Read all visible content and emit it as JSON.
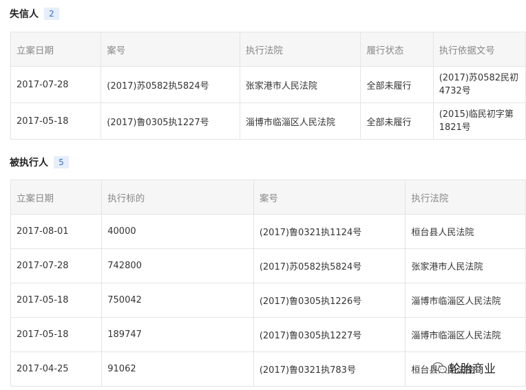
{
  "dishonest": {
    "title": "失信人",
    "count": "2",
    "headers": [
      "立案日期",
      "案号",
      "执行法院",
      "履行状态",
      "执行依据文号"
    ],
    "rows": [
      [
        "2017-07-28",
        "(2017)苏0582执5824号",
        "张家港市人民法院",
        "全部未履行",
        "(2017)苏0582民初4732号"
      ],
      [
        "2017-05-18",
        "(2017)鲁0305执1227号",
        "淄博市临淄区人民法院",
        "全部未履行",
        "(2015)临民初字第1821号"
      ]
    ]
  },
  "executed": {
    "title": "被执行人",
    "count": "5",
    "headers": [
      "立案日期",
      "执行标的",
      "案号",
      "执行法院"
    ],
    "rows": [
      [
        "2017-08-01",
        "40000",
        "(2017)鲁0321执1124号",
        "桓台县人民法院"
      ],
      [
        "2017-07-28",
        "742800",
        "(2017)苏0582执5824号",
        "张家港市人民法院"
      ],
      [
        "2017-05-18",
        "750042",
        "(2017)鲁0305执1226号",
        "淄博市临淄区人民法院"
      ],
      [
        "2017-05-18",
        "189747",
        "(2017)鲁0305执1227号",
        "淄博市临淄区人民法院"
      ],
      [
        "2017-04-25",
        "91062",
        "(2017)鲁0321执783号",
        "桓台县人民法院"
      ]
    ]
  },
  "watermark": {
    "text": "轮胎商业",
    "icon": "wechat-icon"
  },
  "colors": {
    "header_bg": "#f6f6f6",
    "border": "#e4e4e4",
    "badge_bg": "#e6eefb",
    "badge_text": "#3a6fc4"
  }
}
